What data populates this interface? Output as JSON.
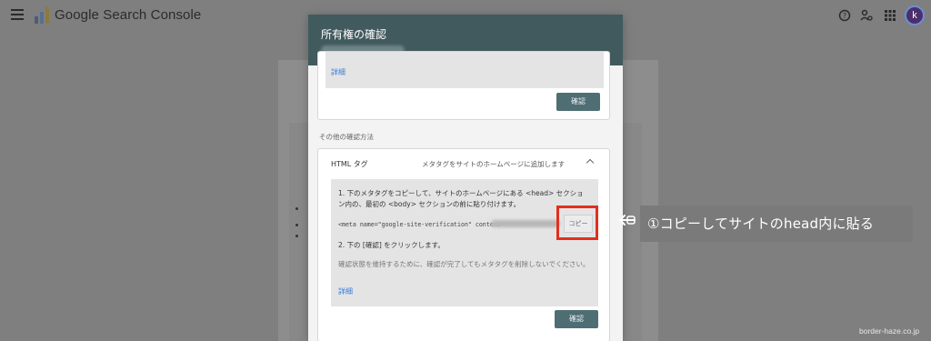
{
  "app": {
    "title": "Google Search Console"
  },
  "topbar": {
    "avatar_letter": "k"
  },
  "dialog": {
    "title": "所有権の確認",
    "first_method": {
      "details_link": "詳細",
      "verify_label": "確認"
    },
    "other_methods_label": "その他の確認方法",
    "html_tag": {
      "title": "HTML タグ",
      "description": "メタタグをサイトのホームページに追加します",
      "step1_line1": "1. 下のメタタグをコピーして、サイトのホームページにある <head> セクショ",
      "step1_line2": "ン内の、最初の <body> セクションの前に貼り付けます。",
      "meta_tag": "<meta name=\"google-site-verification\" content=\"",
      "copy_label": "コピー",
      "step2": "2. 下の [確認] をクリックします。",
      "note": "確認状態を維持するために、確認が完了してもメタタグを削除しないでください。",
      "details_link": "詳細",
      "verify_label": "確認"
    }
  },
  "annotation": {
    "text": "①コピーしてサイトのhead内に貼る",
    "highlight_color": "#e1301d"
  },
  "watermark": "border-haze.co.jp",
  "colors": {
    "header": "#415a5e",
    "button": "#4f6e74",
    "link": "#3b7dd6"
  }
}
